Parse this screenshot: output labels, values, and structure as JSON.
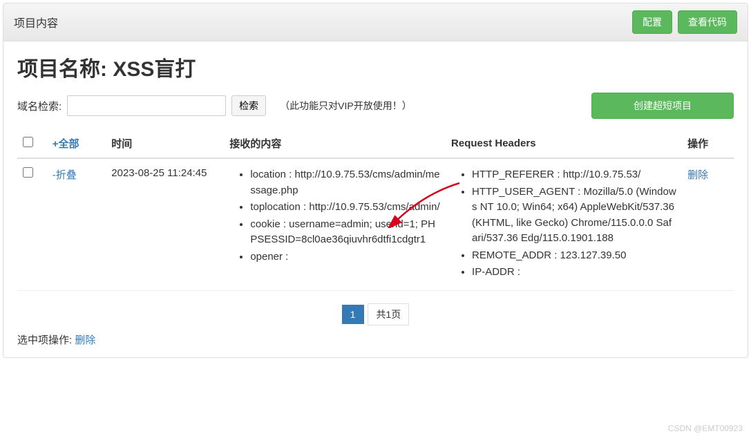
{
  "header": {
    "title": "项目内容",
    "config_btn": "配置",
    "view_code_btn": "查看代码"
  },
  "project": {
    "name_label": "项目名称: XSS盲打"
  },
  "search": {
    "label": "域名检索:",
    "button": "检索",
    "vip_note": "（此功能只对VIP开放使用！）",
    "create_btn": "创建超短项目"
  },
  "table": {
    "headers": {
      "toggle_all": "+全部",
      "time": "时间",
      "content": "接收的内容",
      "request": "Request Headers",
      "action": "操作"
    },
    "row": {
      "toggle": "-折叠",
      "time": "2023-08-25 11:24:45",
      "content": [
        "location : http://10.9.75.53/cms/admin/message.php",
        "toplocation : http://10.9.75.53/cms/admin/",
        "cookie : username=admin; userid=1; PHPSESSID=8cl0ae36qiuvhr6dtfi1cdgtr1",
        "opener :"
      ],
      "headers": [
        "HTTP_REFERER : http://10.9.75.53/",
        "HTTP_USER_AGENT : Mozilla/5.0 (Windows NT 10.0; Win64; x64) AppleWebKit/537.36 (KHTML, like Gecko) Chrome/115.0.0.0 Safari/537.36 Edg/115.0.1901.188",
        "REMOTE_ADDR : 123.127.39.50",
        "IP-ADDR :"
      ],
      "delete": "删除"
    }
  },
  "pagination": {
    "current": "1",
    "total_label": "共1页"
  },
  "footer": {
    "label": "选中项操作:",
    "delete": "删除"
  },
  "watermark": "CSDN @EMT00923"
}
